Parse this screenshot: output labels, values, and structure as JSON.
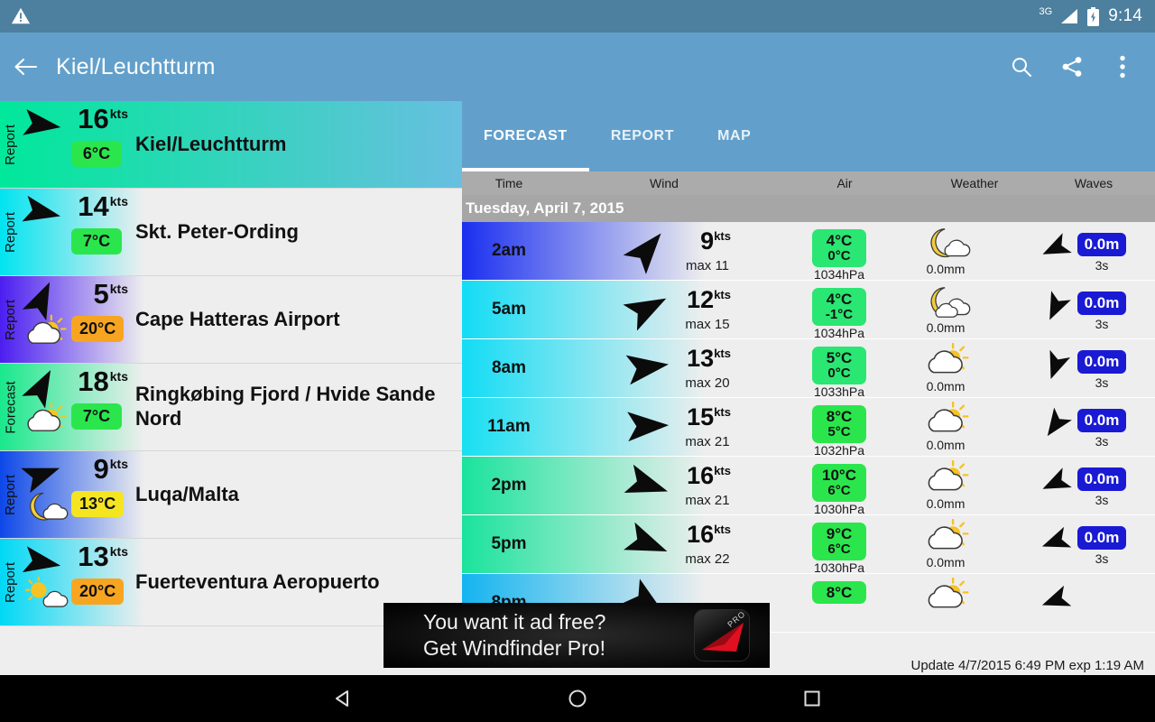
{
  "statusbar": {
    "time": "9:14",
    "network": "3G",
    "warning_icon": "warning-triangle-icon",
    "battery_icon": "battery-charging-icon"
  },
  "appbar": {
    "title": "Kiel/Leuchtturm",
    "back_icon": "back-arrow-icon",
    "search_icon": "search-icon",
    "share_icon": "share-icon",
    "overflow_icon": "overflow-menu-icon"
  },
  "spots": [
    {
      "type": "Report",
      "wind": "16",
      "unit": "kts",
      "temp": "6°C",
      "temp_bg": "#2ae64c",
      "name": "Kiel/Leuchtturm",
      "arrow_deg": 98,
      "weather_icon": "none",
      "grad_from": "#00e89a",
      "grad_to": "#68bfe0",
      "selected": true
    },
    {
      "type": "Report",
      "wind": "14",
      "unit": "kts",
      "temp": "7°C",
      "temp_bg": "#2ae64c",
      "name": "Skt. Peter-Ording",
      "arrow_deg": 102,
      "weather_icon": "none",
      "grad_from": "#00e4f0",
      "grad_to": "#eeeeee",
      "selected": false
    },
    {
      "type": "Report",
      "wind": "5",
      "unit": "kts",
      "temp": "20°C",
      "temp_bg": "#f7a521",
      "name": "Cape Hatteras Airport",
      "arrow_deg": 25,
      "weather_icon": "cloud-sun-icon",
      "grad_from": "#4b1ef0",
      "grad_to": "#eeeeee",
      "selected": false
    },
    {
      "type": "Forecast",
      "wind": "18",
      "unit": "kts",
      "temp": "7°C",
      "temp_bg": "#2ae64c",
      "name": "Ringkøbing Fjord / Hvide Sande Nord",
      "arrow_deg": 28,
      "weather_icon": "cloud-sun-icon",
      "grad_from": "#1ae88c",
      "grad_to": "#eeeeee",
      "selected": false
    },
    {
      "type": "Report",
      "wind": "9",
      "unit": "kts",
      "temp": "13°C",
      "temp_bg": "#f5e520",
      "name": "Luqa/Malta",
      "arrow_deg": 70,
      "weather_icon": "moon-cloud-icon",
      "grad_from": "#0d47e8",
      "grad_to": "#eeeeee",
      "selected": false
    },
    {
      "type": "Report",
      "wind": "13",
      "unit": "kts",
      "temp": "20°C",
      "temp_bg": "#f7a521",
      "name": "Fuerteventura Aeropuerto",
      "arrow_deg": 100,
      "weather_icon": "sun-cloud-icon",
      "grad_from": "#00d8f5",
      "grad_to": "#eeeeee",
      "selected": false
    }
  ],
  "tabs": [
    {
      "label": "FORECAST",
      "active": true
    },
    {
      "label": "REPORT",
      "active": false
    },
    {
      "label": "MAP",
      "active": false
    }
  ],
  "columns": {
    "time": "Time",
    "wind": "Wind",
    "air": "Air",
    "weather": "Weather",
    "waves": "Waves"
  },
  "day_label": "Tuesday, April 7, 2015",
  "forecast": [
    {
      "time": "2am",
      "wind": "9",
      "unit": "kts",
      "max": "max 11",
      "arrow_deg": 40,
      "temp_hi": "4°C",
      "temp_lo": "0°C",
      "temp_bg": "#2ae672",
      "pressure": "1034hPa",
      "weather_icon": "moon-cloud-icon",
      "precip": "0.0mm",
      "wave": "0.0m",
      "wave_arrow_deg": 245,
      "period": "3s",
      "grad_from": "#1a2ff0",
      "grad_to": "#eeeeee"
    },
    {
      "time": "5am",
      "wind": "12",
      "unit": "kts",
      "max": "max 15",
      "arrow_deg": 62,
      "temp_hi": "4°C",
      "temp_lo": "-1°C",
      "temp_bg": "#2ae672",
      "pressure": "1034hPa",
      "weather_icon": "moon-clouds-icon",
      "precip": "0.0mm",
      "wave": "0.0m",
      "wave_arrow_deg": 205,
      "period": "3s",
      "grad_from": "#12dcf5",
      "grad_to": "#eeeeee"
    },
    {
      "time": "8am",
      "wind": "13",
      "unit": "kts",
      "max": "max 20",
      "arrow_deg": 82,
      "temp_hi": "5°C",
      "temp_lo": "0°C",
      "temp_bg": "#2ae672",
      "pressure": "1033hPa",
      "weather_icon": "cloud-sun-icon",
      "precip": "0.0mm",
      "wave": "0.0m",
      "wave_arrow_deg": 200,
      "period": "3s",
      "grad_from": "#12dcf5",
      "grad_to": "#eeeeee"
    },
    {
      "time": "11am",
      "wind": "15",
      "unit": "kts",
      "max": "max 21",
      "arrow_deg": 88,
      "temp_hi": "8°C",
      "temp_lo": "5°C",
      "temp_bg": "#2ae64c",
      "pressure": "1032hPa",
      "weather_icon": "cloud-sun-icon",
      "precip": "0.0mm",
      "wave": "0.0m",
      "wave_arrow_deg": 215,
      "period": "3s",
      "grad_from": "#17dff2",
      "grad_to": "#eeeeee"
    },
    {
      "time": "2pm",
      "wind": "16",
      "unit": "kts",
      "max": "max 21",
      "arrow_deg": 108,
      "temp_hi": "10°C",
      "temp_lo": "6°C",
      "temp_bg": "#2ae64c",
      "pressure": "1030hPa",
      "weather_icon": "cloud-sun-icon",
      "precip": "0.0mm",
      "wave": "0.0m",
      "wave_arrow_deg": 245,
      "period": "3s",
      "grad_from": "#1ae39c",
      "grad_to": "#eeeeee"
    },
    {
      "time": "5pm",
      "wind": "16",
      "unit": "kts",
      "max": "max 22",
      "arrow_deg": 112,
      "temp_hi": "9°C",
      "temp_lo": "6°C",
      "temp_bg": "#2ae64c",
      "pressure": "1030hPa",
      "weather_icon": "cloud-sun-icon",
      "precip": "0.0mm",
      "wave": "0.0m",
      "wave_arrow_deg": 250,
      "period": "3s",
      "grad_from": "#1ae39c",
      "grad_to": "#eeeeee"
    },
    {
      "time": "8pm",
      "wind": "",
      "unit": "",
      "max": "",
      "arrow_deg": 125,
      "temp_hi": "8°C",
      "temp_lo": "",
      "temp_bg": "#2ae64c",
      "pressure": "",
      "weather_icon": "cloud-sun-icon",
      "precip": "",
      "wave": "",
      "wave_arrow_deg": 250,
      "period": "",
      "grad_from": "#14b4f0",
      "grad_to": "#eeeeee"
    }
  ],
  "update_text": "Update 4/7/2015 6:49 PM exp 1:19 AM",
  "ad": {
    "line1": "You want it ad free?",
    "line2": "Get Windfinder Pro!",
    "logo_text": "PRO"
  },
  "navbar": {
    "back_icon": "nav-back-icon",
    "home_icon": "nav-home-icon",
    "recents_icon": "nav-recents-icon"
  }
}
